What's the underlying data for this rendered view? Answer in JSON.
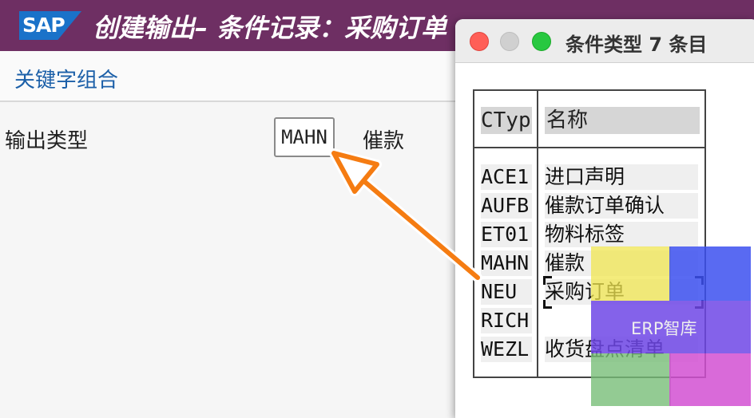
{
  "window": {
    "logo_text": "SAP",
    "title": "创建输出– 条件记录：采购订单"
  },
  "toolbar": {
    "key_combination_label": "关键字组合"
  },
  "form": {
    "output_type_label": "输出类型",
    "output_type_value": "MAHN",
    "output_type_desc": "催款"
  },
  "popup": {
    "title": "条件类型 7 条目",
    "columns": {
      "ctyp": "CTyp",
      "name": "名称"
    },
    "rows": [
      {
        "code": "ACE1",
        "name": "进口声明"
      },
      {
        "code": "AUFB",
        "name": "催款订单确认"
      },
      {
        "code": "ET01",
        "name": "物料标签"
      },
      {
        "code": "MAHN",
        "name": "催款"
      },
      {
        "code": "NEU",
        "name": "采购订单"
      },
      {
        "code": "RICH",
        "name": ""
      },
      {
        "code": "WEZL",
        "name": "收货盘点清单"
      }
    ]
  },
  "watermark": {
    "text": "ERP智库"
  },
  "colors": {
    "title_bar": "#6e2f63",
    "sap_blue": "#1a72c9",
    "link_blue": "#1b5fa8",
    "arrow": "#f57c12"
  }
}
